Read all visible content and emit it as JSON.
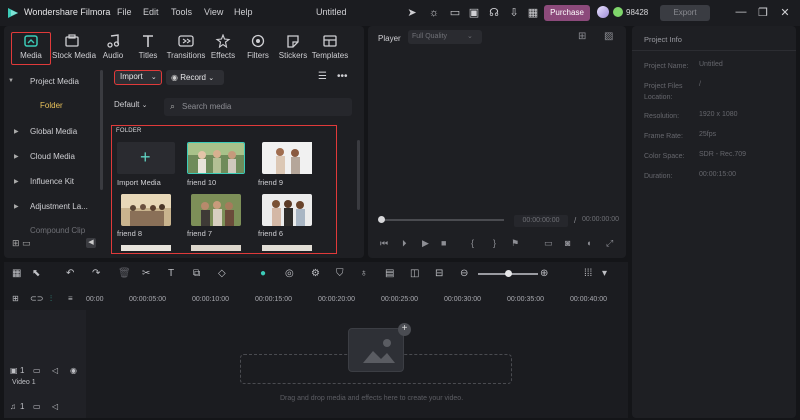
{
  "titlebar": {
    "app_name": "Wondershare Filmora",
    "menu": [
      "File",
      "Edit",
      "Tools",
      "View",
      "Help"
    ],
    "doc_title": "Untitled",
    "purchase": "Purchase",
    "credits": "98428",
    "export": "Export"
  },
  "tabs": [
    {
      "label": "Media",
      "icon": "media-icon"
    },
    {
      "label": "Stock Media",
      "icon": "stock-media-icon"
    },
    {
      "label": "Audio",
      "icon": "audio-icon"
    },
    {
      "label": "Titles",
      "icon": "titles-icon"
    },
    {
      "label": "Transitions",
      "icon": "transitions-icon"
    },
    {
      "label": "Effects",
      "icon": "effects-icon"
    },
    {
      "label": "Filters",
      "icon": "filters-icon"
    },
    {
      "label": "Stickers",
      "icon": "stickers-icon"
    },
    {
      "label": "Templates",
      "icon": "templates-icon"
    }
  ],
  "sidebar": {
    "items": [
      "Project Media",
      "Global Media",
      "Cloud Media",
      "Influence Kit",
      "Adjustment La...",
      "Compound Clip"
    ],
    "selected_child": "Folder"
  },
  "toolbar": {
    "import": "Import",
    "record": "Record",
    "sort": "Default",
    "search_placeholder": "Search media"
  },
  "media": {
    "folder_label": "FOLDER",
    "import_tile": "Import Media",
    "items": [
      "friend 10",
      "friend 9",
      "friend 8",
      "friend 7",
      "friend 6"
    ]
  },
  "player": {
    "label": "Player",
    "quality": "Full Quality",
    "time_current": "00:00:00:00",
    "time_sep": "/",
    "time_total": "00:00:00:00"
  },
  "project_info": {
    "title": "Project Info",
    "rows": [
      {
        "k": "Project Name:",
        "v": "Untitled"
      },
      {
        "k": "Project Files Location:",
        "v": "/"
      },
      {
        "k": "Resolution:",
        "v": "1920 x 1080"
      },
      {
        "k": "Frame Rate:",
        "v": "25fps"
      },
      {
        "k": "Color Space:",
        "v": "SDR - Rec.709"
      },
      {
        "k": "Duration:",
        "v": "00:00:15:00"
      }
    ]
  },
  "timeline": {
    "ticks": [
      "00:00",
      "00:00:05:00",
      "00:00:10:00",
      "00:00:15:00",
      "00:00:20:00",
      "00:00:25:00",
      "00:00:30:00",
      "00:00:35:00",
      "00:00:40:00"
    ],
    "track_label": "Video 1",
    "track_number": "1",
    "drop_hint": "Drag and drop media and effects here to create your video.",
    "zoom_level": 0.5
  },
  "colors": {
    "accent": "#3ccbb8",
    "highlight_box": "#e03a3a",
    "purchase": "#8c4a7b",
    "folder": "#e8c15a"
  }
}
